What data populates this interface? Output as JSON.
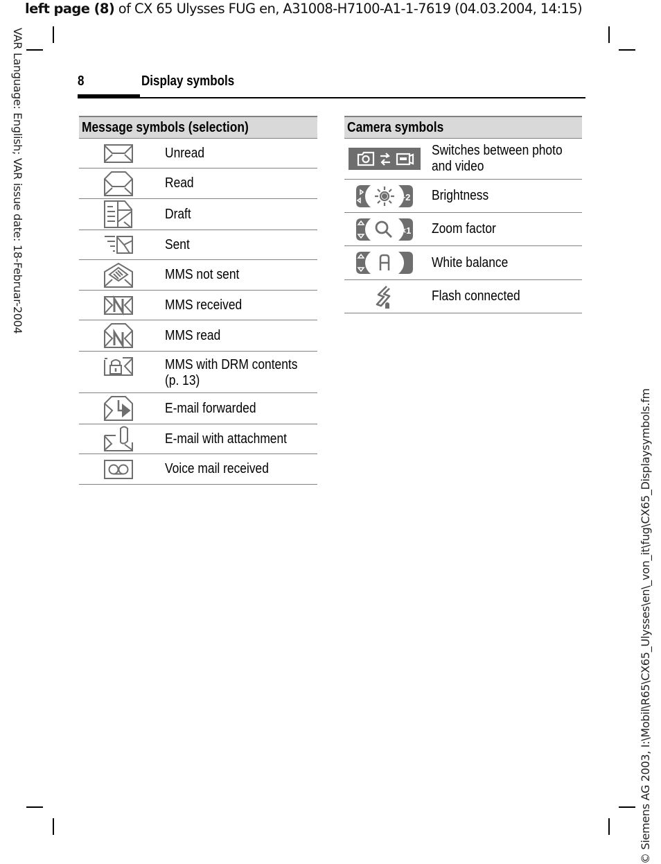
{
  "header": {
    "bold_part": "left page (8)",
    "rest": " of CX 65 Ulysses FUG en, A31008-H7100-A1-1-7619 (04.03.2004, 14:15)"
  },
  "side_left_text": "VAR Language: English; VAR issue date: 18-Februar-2004",
  "side_right_text": "© Siemens AG 2003, I:\\Mobil\\R65\\CX65_Ulysses\\en\\_von_it\\fug\\CX65_Displaysymbols.fm",
  "page": {
    "number": "8",
    "title": "Display symbols"
  },
  "message_table": {
    "heading": "Message symbols (selection)",
    "rows": [
      {
        "icon": "envelope-unread-icon",
        "label": "Unread"
      },
      {
        "icon": "envelope-read-icon",
        "label": "Read"
      },
      {
        "icon": "draft-icon",
        "label": "Draft"
      },
      {
        "icon": "sent-icon",
        "label": "Sent"
      },
      {
        "icon": "mms-not-sent-icon",
        "label": "MMS not sent"
      },
      {
        "icon": "mms-received-icon",
        "label": "MMS received"
      },
      {
        "icon": "mms-read-icon",
        "label": "MMS read"
      },
      {
        "icon": "mms-drm-icon",
        "label": "MMS with DRM contents",
        "label2": "(p. 13)"
      },
      {
        "icon": "email-forwarded-icon",
        "label": "E-mail forwarded"
      },
      {
        "icon": "email-attachment-icon",
        "label": "E-mail with attachment"
      },
      {
        "icon": "voicemail-icon",
        "label": "Voice mail received"
      }
    ]
  },
  "camera_table": {
    "heading": "Camera symbols",
    "rows": [
      {
        "icon": "photo-video-switch-icon",
        "label": "Switches between photo",
        "label2": "and video"
      },
      {
        "icon": "brightness-icon",
        "label": "Brightness",
        "value": "+2"
      },
      {
        "icon": "zoom-factor-icon",
        "label": "Zoom factor",
        "value": "×1"
      },
      {
        "icon": "white-balance-icon",
        "label": "White balance",
        "value": "A"
      },
      {
        "icon": "flash-connected-icon",
        "label": "Flash connected"
      }
    ]
  },
  "colors": {
    "icon_gray": "#6e6e6e",
    "table_header_bg": "#d9d9d9",
    "table_rule": "#808080"
  }
}
